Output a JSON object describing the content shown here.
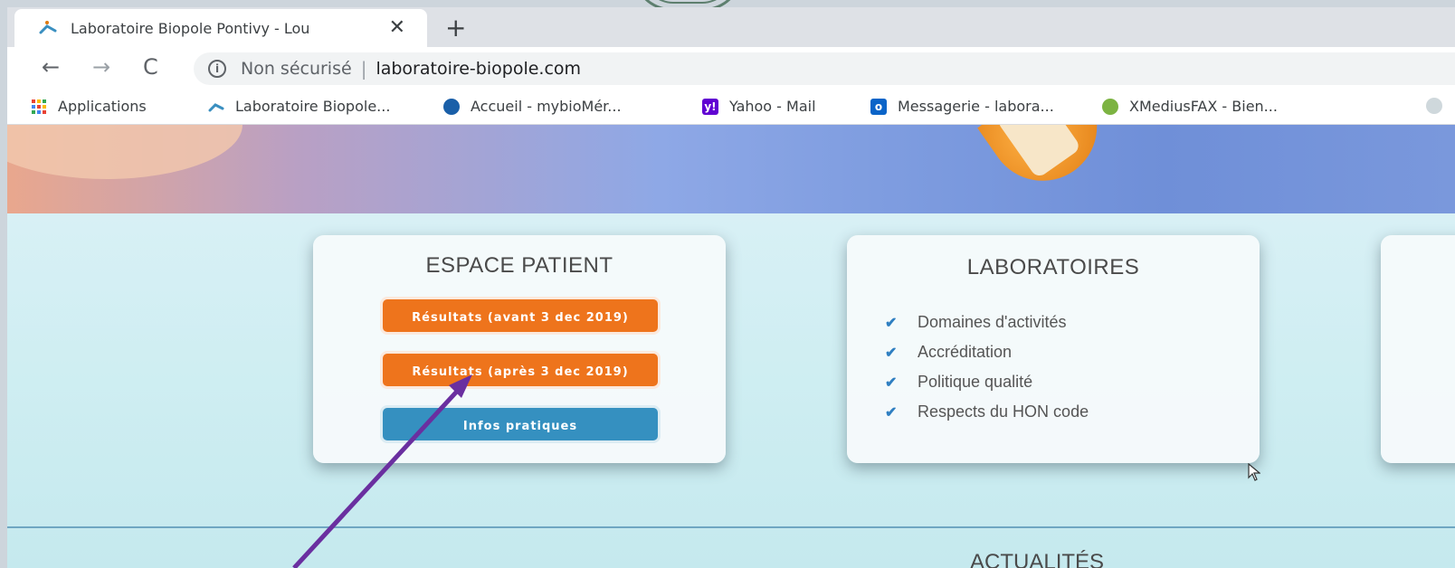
{
  "browser": {
    "tab_title": "Laboratoire Biopole Pontivy - Lou",
    "close_symbol": "✕",
    "new_tab_symbol": "+",
    "security_label": "Non sécurisé",
    "separator": "|",
    "url": "laboratoire-biopole.com",
    "nav": {
      "back": "←",
      "forward": "→",
      "reload": "C"
    }
  },
  "bookmarks": [
    {
      "label": "Applications",
      "icon": "apps-grid-icon",
      "color": "#e94235"
    },
    {
      "label": "Laboratoire Biopole...",
      "icon": "biopole-icon",
      "color": "#3a8fc0"
    },
    {
      "label": "Accueil - mybioMér...",
      "icon": "mybio-icon",
      "color": "#1a5fa8"
    },
    {
      "label": "Yahoo - Mail",
      "icon": "yahoo-icon",
      "color": "#6001d2"
    },
    {
      "label": "Messagerie - labora...",
      "icon": "outlook-icon",
      "color": "#0a64c8"
    },
    {
      "label": "XMediusFAX - Bien...",
      "icon": "xmedius-icon",
      "color": "#7cb342"
    }
  ],
  "espace_patient": {
    "title": "ESPACE PATIENT",
    "buttons": [
      {
        "label": "Résultats (avant 3 dec 2019)"
      },
      {
        "label": "Résultats (après 3 dec 2019)"
      },
      {
        "label": "Infos pratiques"
      }
    ]
  },
  "laboratoires": {
    "title": "LABORATOIRES",
    "items": [
      "Domaines d'activités",
      "Accréditation",
      "Politique qualité",
      "Respects du HON code"
    ]
  },
  "news": {
    "title": "ACTUALITÉS"
  },
  "colors": {
    "orange_button": "#ee741c",
    "blue_button": "#3590c0",
    "annotation_arrow": "#6a2fa0"
  }
}
